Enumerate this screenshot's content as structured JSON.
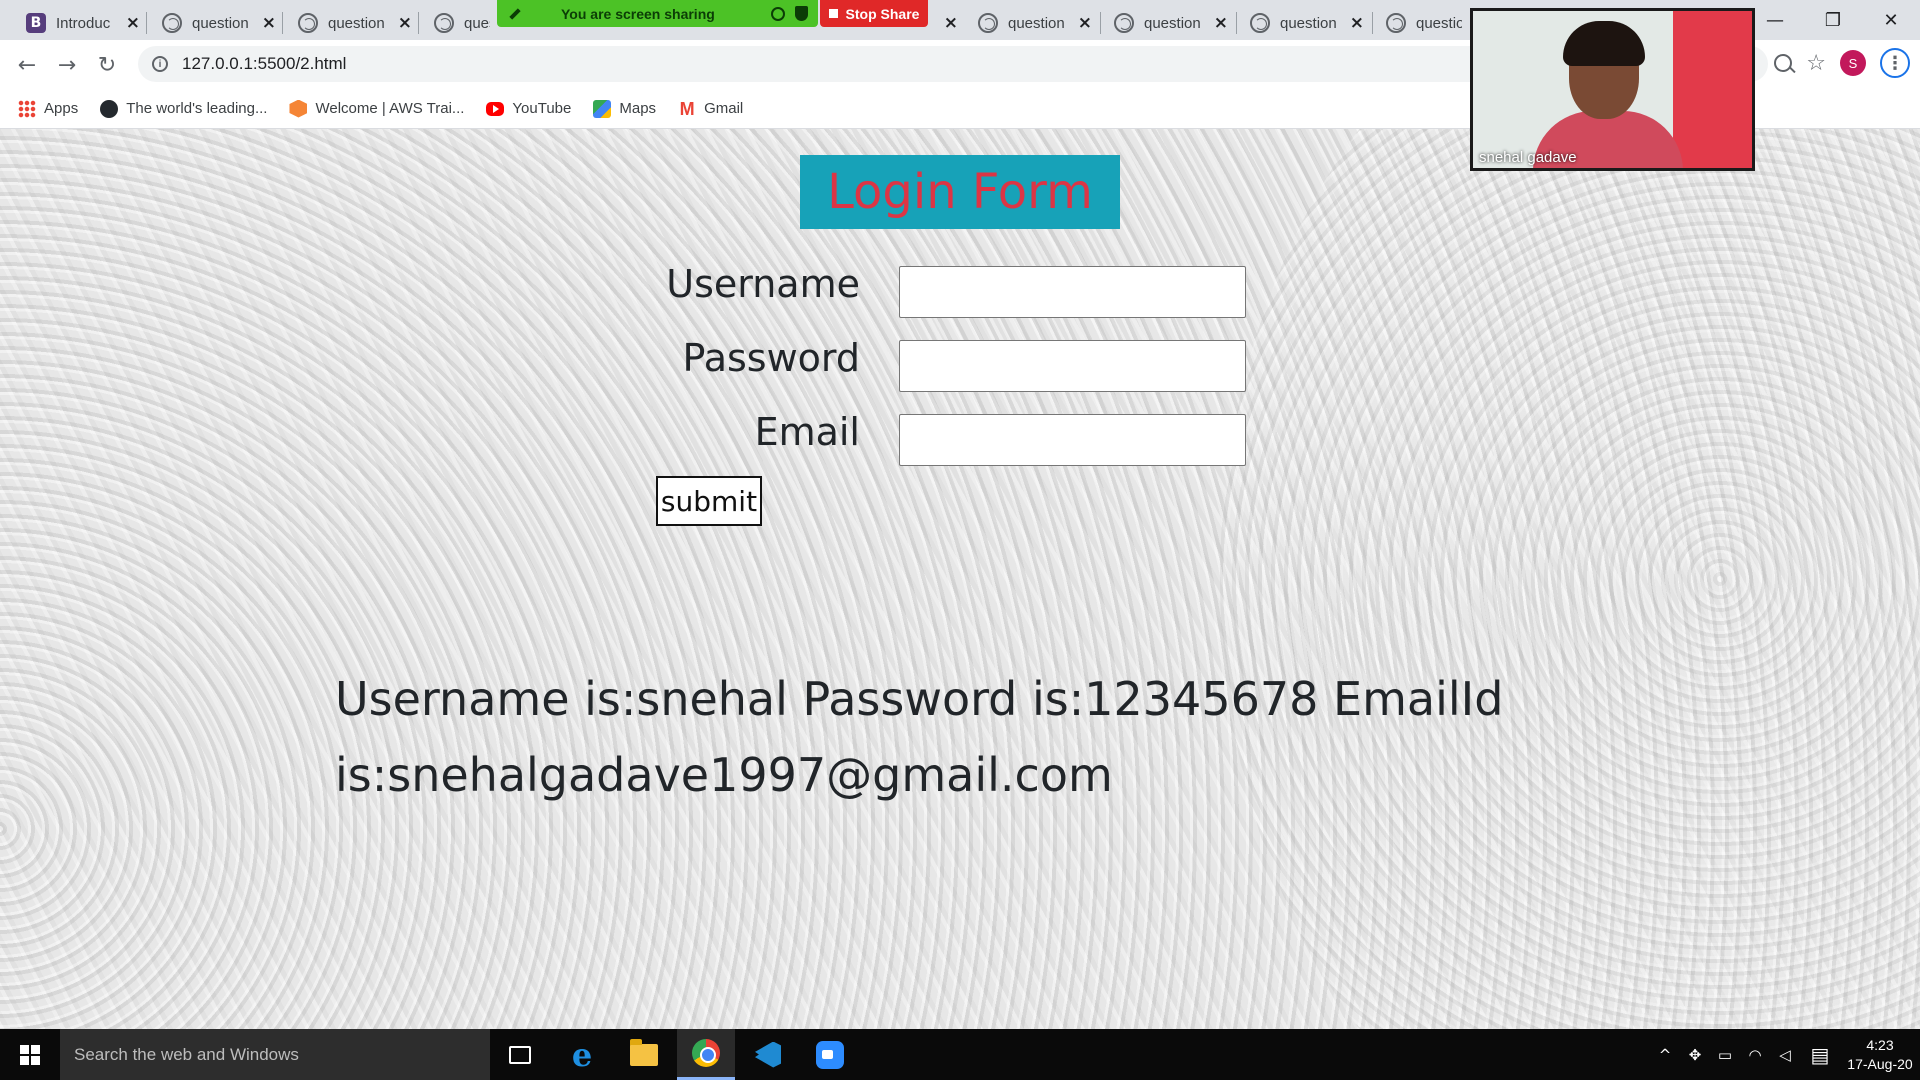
{
  "browser": {
    "tabs": [
      {
        "label": "Introduc",
        "icon": "bootstrap-icon"
      },
      {
        "label": "question",
        "icon": "globe-icon"
      },
      {
        "label": "question",
        "icon": "globe-icon"
      },
      {
        "label": "quest",
        "icon": "globe-icon"
      },
      {
        "label": "question",
        "icon": "globe-icon"
      },
      {
        "label": "question",
        "icon": "globe-icon"
      },
      {
        "label": "question",
        "icon": "globe-icon"
      },
      {
        "label": "questio",
        "icon": "globe-icon"
      }
    ],
    "tab_close": "×",
    "url": "127.0.0.1:5500/2.html",
    "profile_initial": "S",
    "window_controls": {
      "minimize": "—",
      "maximize": "❐",
      "close": "✕"
    }
  },
  "screen_share": {
    "banner_text": "You are screen sharing",
    "stop_label": "Stop Share"
  },
  "bookmarks": [
    {
      "label": "Apps",
      "icon": "apps-icon"
    },
    {
      "label": "The world's leading...",
      "icon": "github-icon"
    },
    {
      "label": "Welcome | AWS Trai...",
      "icon": "aws-icon"
    },
    {
      "label": "YouTube",
      "icon": "youtube-icon"
    },
    {
      "label": "Maps",
      "icon": "maps-icon"
    },
    {
      "label": "Gmail",
      "icon": "gmail-icon"
    }
  ],
  "form": {
    "title": "Login Form",
    "username_label": "Username",
    "password_label": "Password",
    "email_label": "Email",
    "username_value": "",
    "password_value": "",
    "email_value": "",
    "submit_label": "submit",
    "colors": {
      "title_bg": "#17a2b8",
      "title_text": "#dc3545"
    }
  },
  "output": {
    "line1": "Username is:snehal Password is:12345678 EmailId",
    "line2": "is:snehalgadave1997@gmail.com"
  },
  "video": {
    "participant_name": "snehal gadave"
  },
  "taskbar": {
    "search_placeholder": "Search the web and Windows",
    "time": "4:23",
    "date": "17-Aug-20"
  }
}
